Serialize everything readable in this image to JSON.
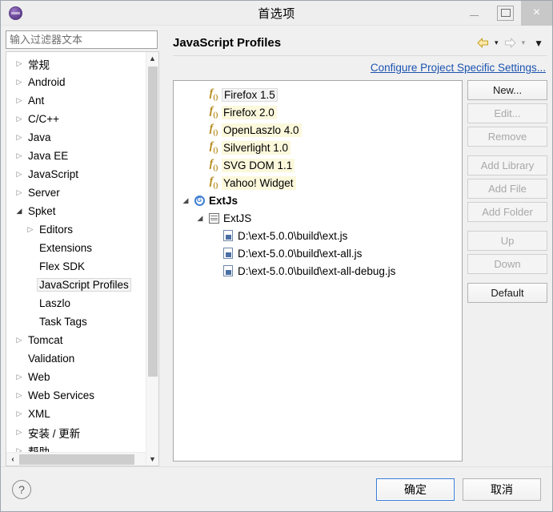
{
  "window": {
    "title": "首选项",
    "app_icon": "eclipse-icon",
    "controls": {
      "minimize": "minimize-icon",
      "maximize": "maximize-icon",
      "close": "×"
    }
  },
  "sidebar": {
    "filter": {
      "placeholder": "输入过滤器文本",
      "value": ""
    },
    "items": [
      {
        "label": "常规",
        "indent": 0,
        "arrow": "collapsed",
        "selected": false
      },
      {
        "label": "Android",
        "indent": 0,
        "arrow": "collapsed",
        "selected": false
      },
      {
        "label": "Ant",
        "indent": 0,
        "arrow": "collapsed",
        "selected": false
      },
      {
        "label": "C/C++",
        "indent": 0,
        "arrow": "collapsed",
        "selected": false
      },
      {
        "label": "Java",
        "indent": 0,
        "arrow": "collapsed",
        "selected": false
      },
      {
        "label": "Java EE",
        "indent": 0,
        "arrow": "collapsed",
        "selected": false
      },
      {
        "label": "JavaScript",
        "indent": 0,
        "arrow": "collapsed",
        "selected": false
      },
      {
        "label": "Server",
        "indent": 0,
        "arrow": "collapsed",
        "selected": false
      },
      {
        "label": "Spket",
        "indent": 0,
        "arrow": "expanded",
        "selected": false
      },
      {
        "label": "Editors",
        "indent": 1,
        "arrow": "collapsed",
        "selected": false
      },
      {
        "label": "Extensions",
        "indent": 1,
        "arrow": "none",
        "selected": false
      },
      {
        "label": "Flex SDK",
        "indent": 1,
        "arrow": "none",
        "selected": false
      },
      {
        "label": "JavaScript Profiles",
        "indent": 1,
        "arrow": "none",
        "selected": true
      },
      {
        "label": "Laszlo",
        "indent": 1,
        "arrow": "none",
        "selected": false
      },
      {
        "label": "Task Tags",
        "indent": 1,
        "arrow": "none",
        "selected": false
      },
      {
        "label": "Tomcat",
        "indent": 0,
        "arrow": "collapsed",
        "selected": false
      },
      {
        "label": "Validation",
        "indent": 0,
        "arrow": "none",
        "selected": false
      },
      {
        "label": "Web",
        "indent": 0,
        "arrow": "collapsed",
        "selected": false
      },
      {
        "label": "Web Services",
        "indent": 0,
        "arrow": "collapsed",
        "selected": false
      },
      {
        "label": "XML",
        "indent": 0,
        "arrow": "collapsed",
        "selected": false
      },
      {
        "label": "安装 / 更新",
        "indent": 0,
        "arrow": "collapsed",
        "selected": false
      },
      {
        "label": "帮助",
        "indent": 0,
        "arrow": "collapsed",
        "selected": false
      }
    ],
    "scroll": {
      "up": "▲",
      "down": "▼",
      "left": "‹",
      "right": "›"
    }
  },
  "page": {
    "title": "JavaScript Profiles",
    "nav": {
      "back": "back-arrow-icon",
      "back_menu": "▾",
      "forward": "forward-arrow-icon",
      "forward_menu": "▾",
      "view_menu": "▼"
    },
    "configure_link": "Configure Project Specific Settings..."
  },
  "profiles": [
    {
      "label": "Firefox 1.5",
      "icon": "function-icon",
      "kind": "profile",
      "selected": true,
      "indent": 1
    },
    {
      "label": "Firefox 2.0",
      "icon": "function-icon",
      "kind": "profile",
      "selected": false,
      "indent": 1
    },
    {
      "label": "OpenLaszlo 4.0",
      "icon": "function-icon",
      "kind": "profile",
      "selected": false,
      "indent": 1
    },
    {
      "label": "Silverlight 1.0",
      "icon": "function-icon",
      "kind": "profile",
      "selected": false,
      "indent": 1
    },
    {
      "label": "SVG DOM 1.1",
      "icon": "function-icon",
      "kind": "profile",
      "selected": false,
      "indent": 1
    },
    {
      "label": "Yahoo! Widget",
      "icon": "function-icon",
      "kind": "profile",
      "selected": false,
      "indent": 1
    },
    {
      "label": "ExtJs",
      "icon": "profile-group-icon",
      "kind": "group",
      "expanded": true,
      "indent": 0
    },
    {
      "label": "ExtJS",
      "icon": "library-icon",
      "kind": "library",
      "expanded": true,
      "indent": 1
    },
    {
      "label": "D:\\ext-5.0.0\\build\\ext.js",
      "icon": "js-file-icon",
      "kind": "file",
      "indent": 2
    },
    {
      "label": "D:\\ext-5.0.0\\build\\ext-all.js",
      "icon": "js-file-icon",
      "kind": "file",
      "indent": 2
    },
    {
      "label": "D:\\ext-5.0.0\\build\\ext-all-debug.js",
      "icon": "js-file-icon",
      "kind": "file",
      "indent": 2
    }
  ],
  "buttons": [
    {
      "label": "New...",
      "enabled": true,
      "gap": false
    },
    {
      "label": "Edit...",
      "enabled": false,
      "gap": false
    },
    {
      "label": "Remove",
      "enabled": false,
      "gap": false
    },
    {
      "label": "Add Library",
      "enabled": false,
      "gap": true
    },
    {
      "label": "Add File",
      "enabled": false,
      "gap": false
    },
    {
      "label": "Add Folder",
      "enabled": false,
      "gap": false
    },
    {
      "label": "Up",
      "enabled": false,
      "gap": true
    },
    {
      "label": "Down",
      "enabled": false,
      "gap": false
    },
    {
      "label": "Default",
      "enabled": true,
      "gap": true
    }
  ],
  "footer": {
    "help": "?",
    "ok": "确定",
    "cancel": "取消"
  },
  "colors": {
    "link": "#1b52b0",
    "profile_highlight": "#fbf8dc",
    "default_button_border": "#3b7dd8",
    "function_icon": "#b58a1b"
  }
}
